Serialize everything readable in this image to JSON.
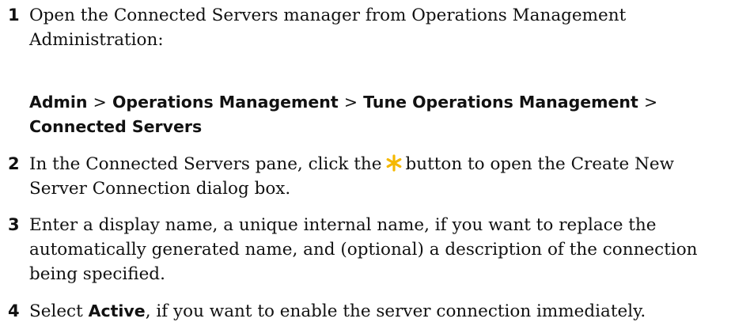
{
  "steps": [
    {
      "number": "1",
      "text": "Open the Connected Servers manager from Operations Management Administration:",
      "path": [
        "Admin",
        "Operations Management",
        "Tune Operations Management",
        "Connected Servers"
      ],
      "separator": ">"
    },
    {
      "number": "2",
      "text_before": "In the Connected Servers pane, click the",
      "icon": "new-star-icon",
      "text_after": "button to open the Create New Server Connection dialog box."
    },
    {
      "number": "3",
      "text": "Enter a display name, a unique internal name, if you want to replace the automatically generated name, and (optional) a description of the connection being specified."
    },
    {
      "number": "4",
      "text_before": "Select",
      "bold": "Active",
      "text_after": ", if you want to enable the server connection immediately."
    }
  ],
  "colors": {
    "text": "#111111",
    "star": "#F5B800"
  }
}
